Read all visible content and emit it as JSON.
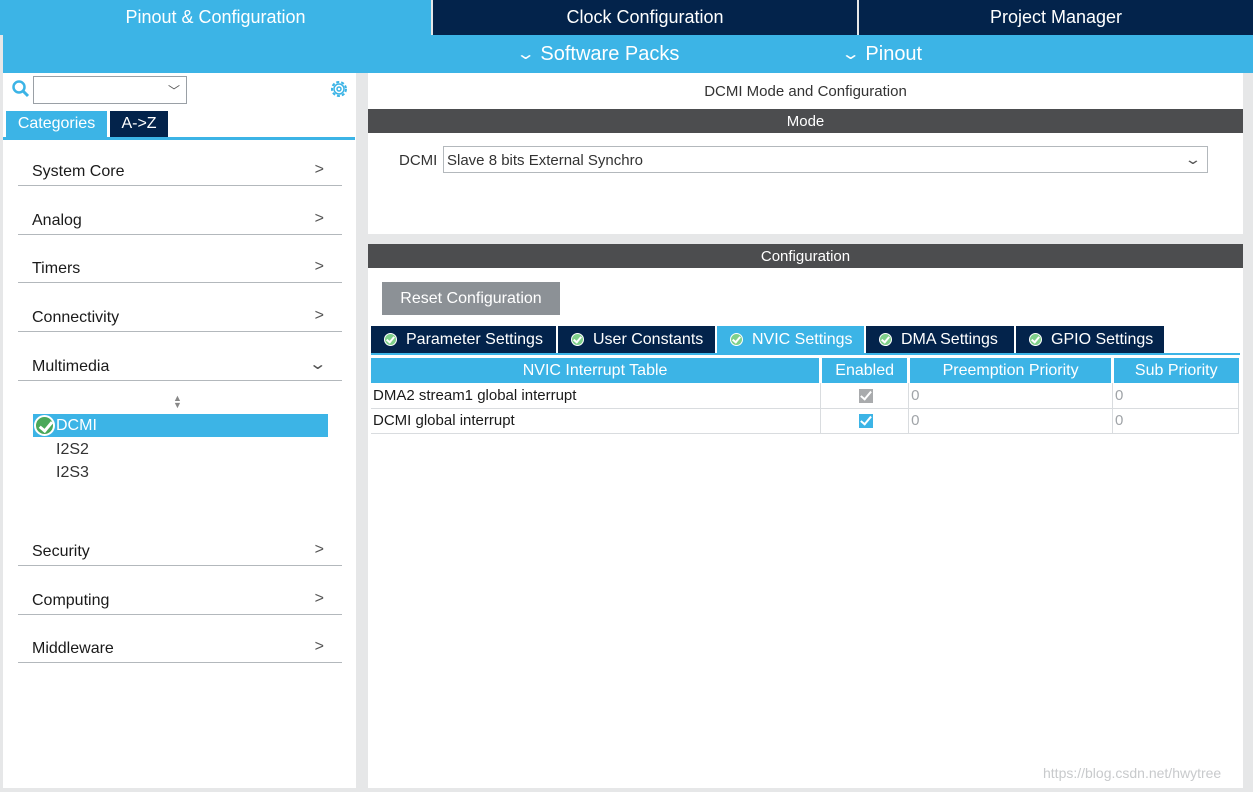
{
  "top_tabs": [
    {
      "label": "Pinout & Configuration",
      "active": true
    },
    {
      "label": "Clock Configuration",
      "active": false
    },
    {
      "label": "Project Manager",
      "active": false
    }
  ],
  "sub_menu": {
    "software_packs": "Software Packs",
    "pinout": "Pinout"
  },
  "left_panel": {
    "view_tabs": {
      "categories": "Categories",
      "az": "A->Z"
    },
    "categories": [
      {
        "label": "System Core",
        "expanded": false
      },
      {
        "label": "Analog",
        "expanded": false
      },
      {
        "label": "Timers",
        "expanded": false
      },
      {
        "label": "Connectivity",
        "expanded": false
      },
      {
        "label": "Multimedia",
        "expanded": true
      },
      {
        "label": "Security",
        "expanded": false
      },
      {
        "label": "Computing",
        "expanded": false
      },
      {
        "label": "Middleware",
        "expanded": false
      }
    ],
    "multimedia_items": [
      {
        "label": "DCMI",
        "selected": true,
        "configured": true
      },
      {
        "label": "I2S2",
        "selected": false,
        "configured": false
      },
      {
        "label": "I2S3",
        "selected": false,
        "configured": false
      }
    ]
  },
  "mode": {
    "title": "DCMI Mode and Configuration",
    "header": "Mode",
    "field_label": "DCMI",
    "field_value": "Slave 8 bits External Synchro"
  },
  "configuration": {
    "header": "Configuration",
    "reset_label": "Reset Configuration",
    "tabs": [
      {
        "label": "Parameter Settings",
        "active": false
      },
      {
        "label": "User Constants",
        "active": false
      },
      {
        "label": "NVIC Settings",
        "active": true
      },
      {
        "label": "DMA Settings",
        "active": false
      },
      {
        "label": "GPIO Settings",
        "active": false
      }
    ],
    "table": {
      "columns": [
        "NVIC Interrupt Table",
        "Enabled",
        "Preemption Priority",
        "Sub Priority"
      ],
      "rows": [
        {
          "name": "DMA2 stream1 global interrupt",
          "enabled": true,
          "enabled_editable": false,
          "preemption": "0",
          "sub": "0"
        },
        {
          "name": "DCMI global interrupt",
          "enabled": true,
          "enabled_editable": true,
          "preemption": "0",
          "sub": "0"
        }
      ]
    }
  },
  "watermark": "https://blog.csdn.net/hwytree",
  "colors": {
    "accent": "#3cb4e6",
    "navy": "#03234b",
    "band": "#4c4d4f"
  }
}
